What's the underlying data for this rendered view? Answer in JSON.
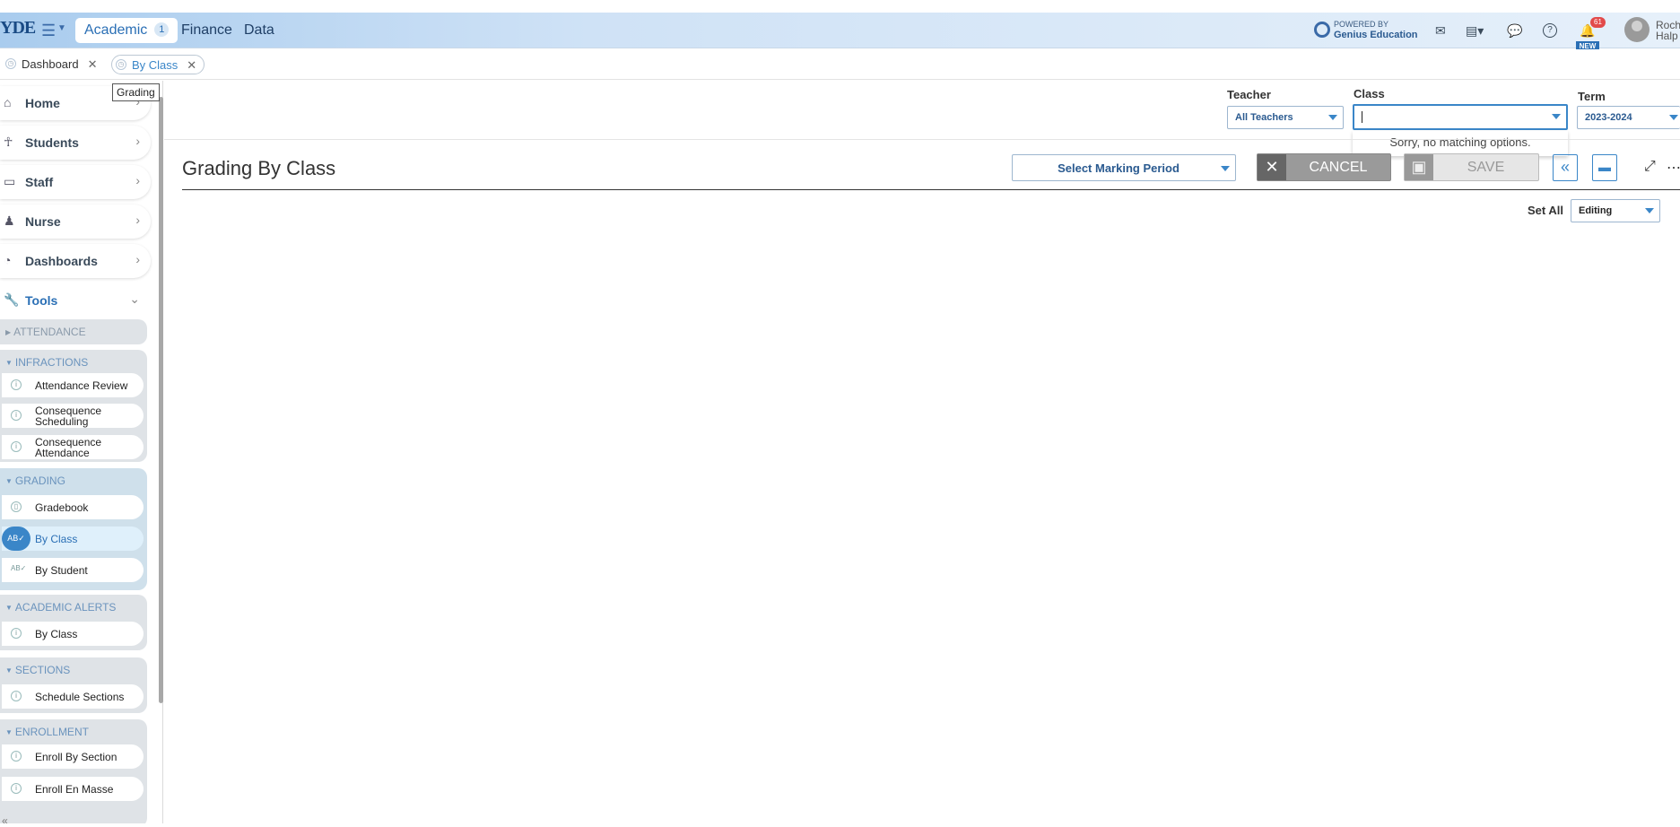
{
  "topbar": {
    "logo": "YDE",
    "modules": [
      {
        "label": "Academic",
        "count": "1"
      },
      {
        "label": "Finance"
      },
      {
        "label": "Data"
      }
    ],
    "powered_by": "POWERED BY",
    "powered_brand": "Genius Education",
    "notification_count": "61",
    "new_tag": "NEW",
    "user_name_line1": "Roch",
    "user_name_line2": "Halp"
  },
  "tabs": [
    {
      "label": "Dashboard"
    },
    {
      "label": "By Class"
    }
  ],
  "tooltip": "Grading",
  "sidebar": {
    "nav": [
      {
        "label": "Home"
      },
      {
        "label": "Students"
      },
      {
        "label": "Staff"
      },
      {
        "label": "Nurse"
      },
      {
        "label": "Dashboards"
      },
      {
        "label": "Tools"
      }
    ],
    "groups": [
      {
        "header": "ATTENDANCE",
        "items": []
      },
      {
        "header": "INFRACTIONS",
        "items": [
          "Attendance Review",
          "Consequence Scheduling",
          "Consequence Attendance"
        ]
      },
      {
        "header": "GRADING",
        "items": [
          "Gradebook",
          "By Class",
          "By Student"
        ]
      },
      {
        "header": "ACADEMIC ALERTS",
        "items": [
          "By Class"
        ]
      },
      {
        "header": "SECTIONS",
        "items": [
          "Schedule Sections"
        ]
      },
      {
        "header": "ENROLLMENT",
        "items": [
          "Enroll By Section",
          "Enroll En Masse"
        ]
      }
    ]
  },
  "filters": {
    "teacher_label": "Teacher",
    "teacher_value": "All Teachers",
    "class_label": "Class",
    "class_value": "",
    "class_no_match": "Sorry, no matching options.",
    "term_label": "Term",
    "term_value": "2023-2024"
  },
  "main": {
    "title": "Grading By Class",
    "marking_period_placeholder": "Select Marking Period",
    "cancel_label": "CANCEL",
    "save_label": "SAVE",
    "set_all_label": "Set All",
    "set_all_value": "Editing"
  },
  "colors": {
    "accent": "#3a86c8",
    "brand": "#2a6fb5",
    "badge": "#e24a4a"
  }
}
